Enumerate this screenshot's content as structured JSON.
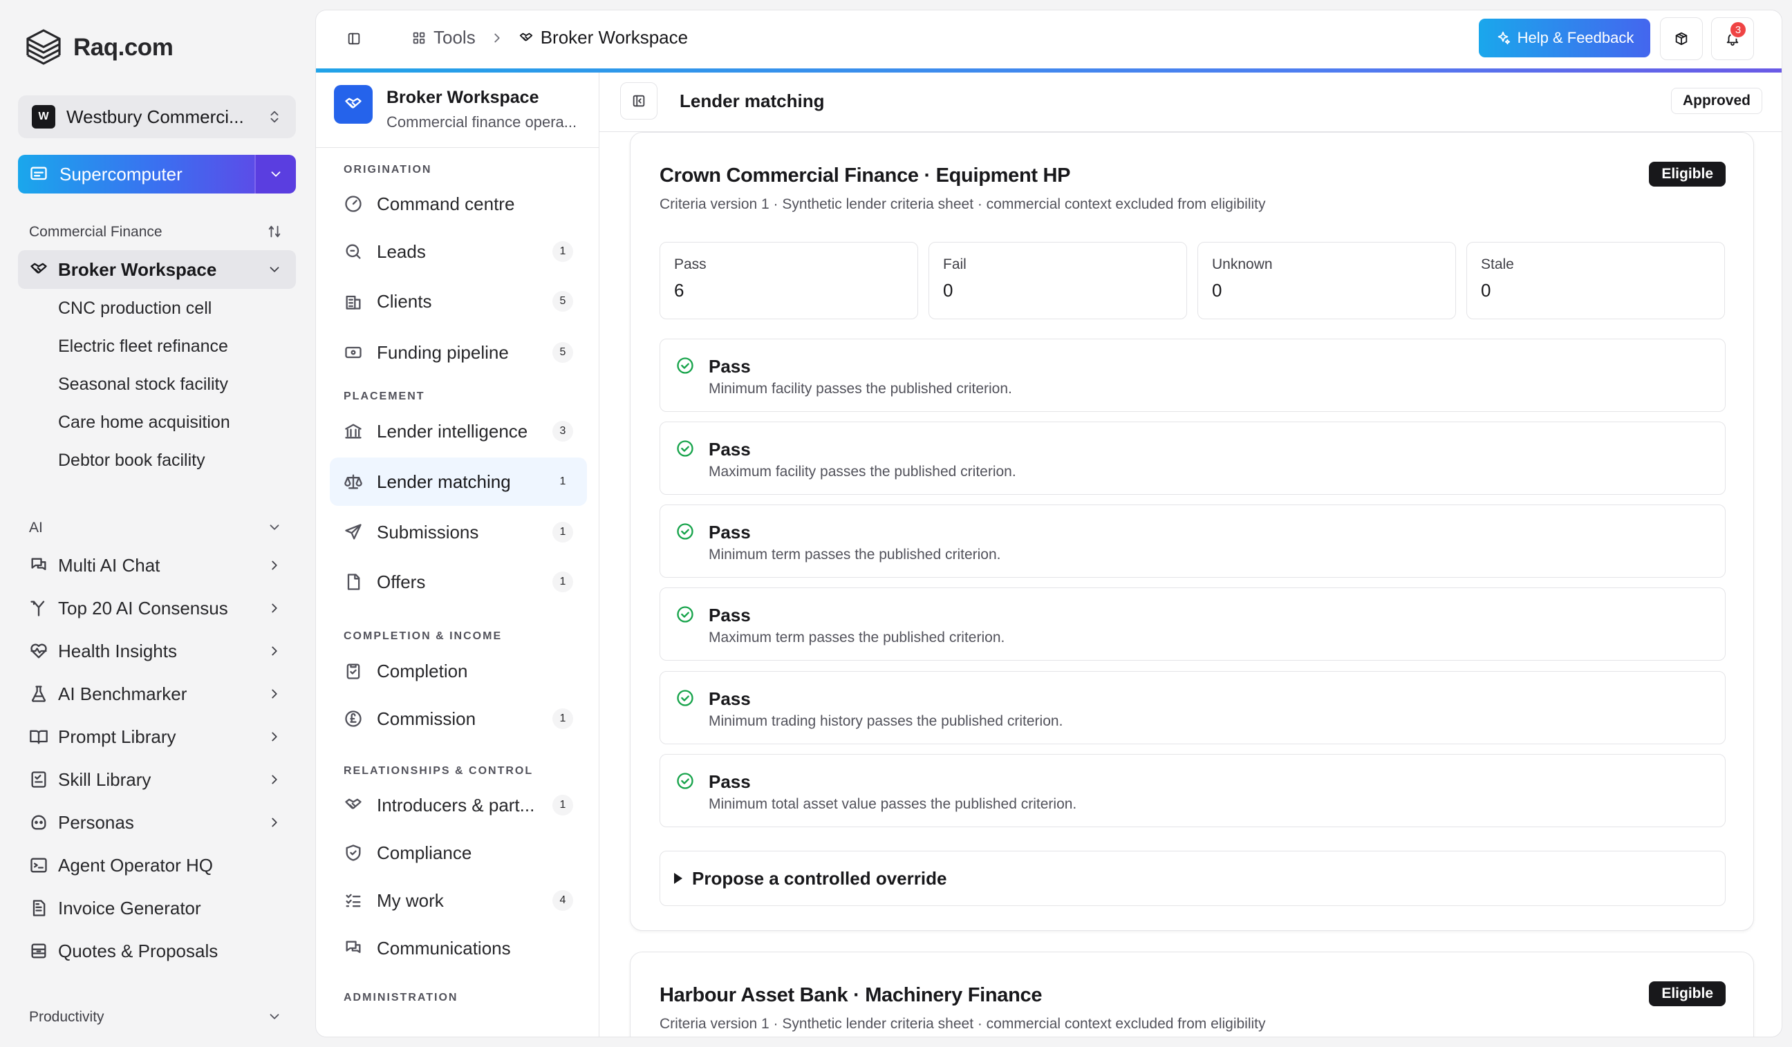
{
  "app": {
    "name": "Raq.com"
  },
  "org": {
    "avatar": "W",
    "name": "Westbury Commerci..."
  },
  "supercomputer": {
    "label": "Supercomputer"
  },
  "sidebar": {
    "section_commercial": "Commercial Finance",
    "broker_workspace": "Broker Workspace",
    "sub_items": [
      "CNC production cell",
      "Electric fleet refinance",
      "Seasonal stock facility",
      "Care home acquisition",
      "Debtor book facility"
    ],
    "section_ai": "AI",
    "ai_items": [
      {
        "label": "Multi AI Chat",
        "icon": "chat-icon"
      },
      {
        "label": "Top 20 AI Consensus",
        "icon": "fork-icon"
      },
      {
        "label": "Health Insights",
        "icon": "heart-icon"
      },
      {
        "label": "AI Benchmarker",
        "icon": "flask-icon"
      },
      {
        "label": "Prompt Library",
        "icon": "book-icon"
      },
      {
        "label": "Skill Library",
        "icon": "checklist-icon"
      },
      {
        "label": "Personas",
        "icon": "persona-icon"
      },
      {
        "label": "Agent Operator HQ",
        "icon": "terminal-icon"
      },
      {
        "label": "Invoice Generator",
        "icon": "invoice-icon"
      },
      {
        "label": "Quotes & Proposals",
        "icon": "archive-icon"
      }
    ],
    "section_productivity": "Productivity"
  },
  "topbar": {
    "tools": "Tools",
    "workspace": "Broker Workspace",
    "help": "Help & Feedback",
    "notif_count": "3"
  },
  "workspace": {
    "title": "Broker Workspace",
    "subtitle": "Commercial finance opera...",
    "groups": {
      "origination": "ORIGINATION",
      "placement": "PLACEMENT",
      "completion": "COMPLETION & INCOME",
      "relationships": "RELATIONSHIPS & CONTROL",
      "administration": "ADMINISTRATION"
    },
    "items": [
      {
        "label": "Command centre",
        "count": ""
      },
      {
        "label": "Leads",
        "count": "1"
      },
      {
        "label": "Clients",
        "count": "5"
      },
      {
        "label": "Funding pipeline",
        "count": "5"
      },
      {
        "label": "Lender intelligence",
        "count": "3"
      },
      {
        "label": "Lender matching",
        "count": "1"
      },
      {
        "label": "Submissions",
        "count": "1"
      },
      {
        "label": "Offers",
        "count": "1"
      },
      {
        "label": "Completion",
        "count": ""
      },
      {
        "label": "Commission",
        "count": "1"
      },
      {
        "label": "Introducers & part...",
        "count": "1"
      },
      {
        "label": "Compliance",
        "count": ""
      },
      {
        "label": "My work",
        "count": "4"
      },
      {
        "label": "Communications",
        "count": ""
      }
    ]
  },
  "content": {
    "title": "Lender matching",
    "status": "Approved",
    "lender1": {
      "name": "Crown Commercial Finance · Equipment HP",
      "subtitle": "Criteria version 1 · Synthetic lender criteria sheet · commercial context excluded from eligibility",
      "badge": "Eligible",
      "stats": [
        {
          "label": "Pass",
          "value": "6"
        },
        {
          "label": "Fail",
          "value": "0"
        },
        {
          "label": "Unknown",
          "value": "0"
        },
        {
          "label": "Stale",
          "value": "0"
        }
      ],
      "criteria": [
        {
          "status": "Pass",
          "desc": "Minimum facility passes the published criterion."
        },
        {
          "status": "Pass",
          "desc": "Maximum facility passes the published criterion."
        },
        {
          "status": "Pass",
          "desc": "Minimum term passes the published criterion."
        },
        {
          "status": "Pass",
          "desc": "Maximum term passes the published criterion."
        },
        {
          "status": "Pass",
          "desc": "Minimum trading history passes the published criterion."
        },
        {
          "status": "Pass",
          "desc": "Minimum total asset value passes the published criterion."
        }
      ],
      "override": "Propose a controlled override"
    },
    "lender2": {
      "name": "Harbour Asset Bank · Machinery Finance",
      "subtitle": "Criteria version 1 · Synthetic lender criteria sheet · commercial context excluded from eligibility",
      "badge": "Eligible"
    }
  }
}
